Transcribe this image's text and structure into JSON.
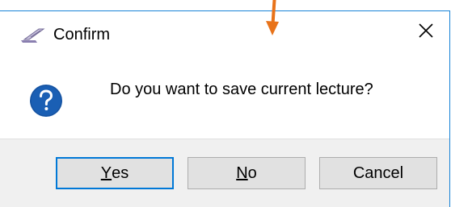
{
  "dialog": {
    "title": "Confirm",
    "message": "Do you want to save current lecture?",
    "icons": {
      "app": "quill-pen-icon",
      "close": "close-icon",
      "question": "question-icon",
      "pointer": "arrow-down-icon"
    },
    "buttons": {
      "yes": {
        "mnemonic": "Y",
        "rest": "es",
        "is_default": true
      },
      "no": {
        "mnemonic": "N",
        "rest": "o"
      },
      "cancel": {
        "label": "Cancel"
      }
    }
  },
  "colors": {
    "accent": "#0078d7",
    "window_border": "#1883d7",
    "question_icon_fill": "#1a5fb4",
    "footer_bg": "#f0f0f0",
    "button_bg": "#e1e1e1",
    "annotation_arrow": "#e8731a"
  }
}
